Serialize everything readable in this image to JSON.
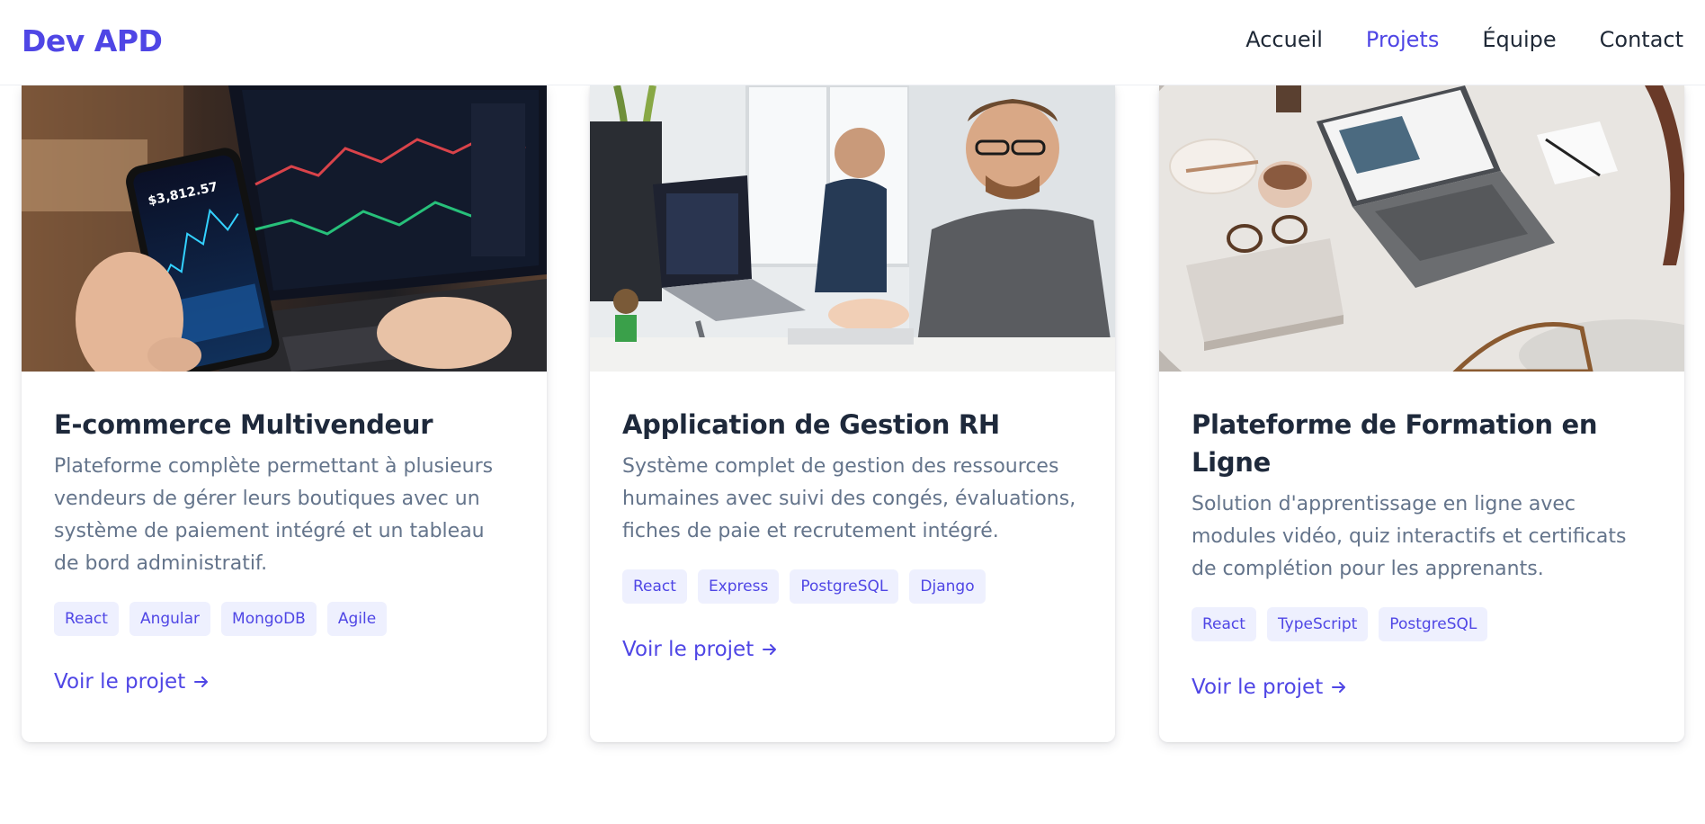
{
  "navbar": {
    "logo": "Dev APD",
    "links": [
      {
        "label": "Accueil"
      },
      {
        "label": "Projets"
      },
      {
        "label": "Équipe"
      },
      {
        "label": "Contact"
      }
    ],
    "active": "Projets"
  },
  "projects": [
    {
      "title": "E-commerce Multivendeur",
      "description": "Plateforme complète permettant à plusieurs vendeurs de gérer leurs boutiques avec un système de paiement intégré et un tableau de bord administratif.",
      "tags": [
        "React",
        "Angular",
        "MongoDB",
        "Agile"
      ],
      "link_label": "Voir le projet",
      "image": "phone-trading-app-over-laptop-photo"
    },
    {
      "title": "Application de Gestion RH",
      "description": "Système complet de gestion des ressources humaines avec suivi des congés, évaluations, fiches de paie et recrutement intégré.",
      "tags": [
        "React",
        "Express",
        "PostgreSQL",
        "Django"
      ],
      "link_label": "Voir le projet",
      "image": "developers-working-at-desks-photo"
    },
    {
      "title": "Plateforme de Formation en Ligne",
      "description": "Solution d'apprentissage en ligne avec modules vidéo, quiz interactifs et certificats de complétion pour les apprenants.",
      "tags": [
        "React",
        "TypeScript",
        "PostgreSQL"
      ],
      "link_label": "Voir le projet",
      "image": "laptop-on-marble-table-photo"
    }
  ],
  "colors": {
    "brand": "#4f46e5",
    "heading": "#1e293b",
    "body_text": "#64748b",
    "tag_bg": "#eef0fe"
  }
}
